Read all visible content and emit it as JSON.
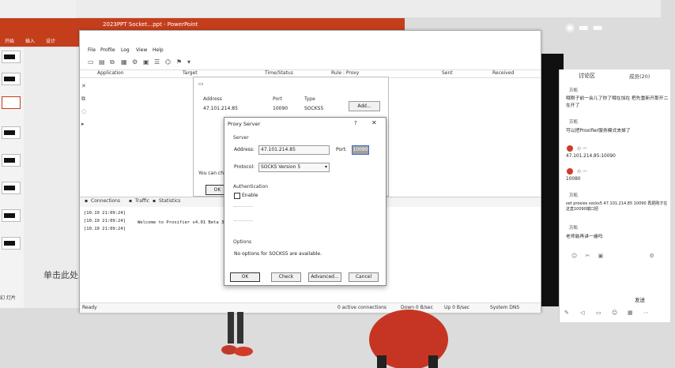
{
  "powerpoint": {
    "title": "2023PPT Socket…ppt - PowerPoint",
    "ribbon": [
      "开始",
      "插入",
      "设计"
    ],
    "slide_text": "单击此处",
    "status": "幻 灯片"
  },
  "proxifier": {
    "menu": [
      "File",
      "Profile",
      "Log",
      "View",
      "Help"
    ],
    "columns": [
      "Application",
      "Target",
      "Time/Status",
      "Rule : Proxy",
      "Sent",
      "Received"
    ],
    "servers": {
      "headers": [
        "Address",
        "Port",
        "Type"
      ],
      "row": {
        "address": "47.101.214.85",
        "port": "10090",
        "type": "SOCKS5"
      },
      "add_label": "Add...",
      "hint": "You can che",
      "ok_label": "OK"
    },
    "tabs": [
      "Connections",
      "Traffic",
      "Statistics"
    ],
    "log": [
      "[10.19 21:09:24]",
      "[10.19 21:09:24]",
      "[10.19 21:09:24]"
    ],
    "welcome": "Welcome to Proxifier v4.01 Beta 3",
    "status": {
      "ready": "Ready",
      "connections": "0 active connections",
      "down": "Down 0 B/sec",
      "up": "Up 0 B/sec",
      "dns": "System DNS"
    }
  },
  "dialog": {
    "title": "Proxy Server",
    "help": "?",
    "close": "✕",
    "server_section": "Server",
    "address_label": "Address:",
    "address_value": "47.101.214.85",
    "port_label": "Port:",
    "port_value": "10090",
    "protocol_label": "Protocol:",
    "protocol_value": "SOCKS Version 5",
    "auth_section": "Authentication",
    "enable_label": "Enable",
    "options_section": "Options",
    "options_text": "No options for SOCKS5 are available.",
    "buttons": {
      "ok": "OK",
      "check": "Check",
      "advanced": "Advanced...",
      "cancel": "Cancel"
    }
  },
  "chat": {
    "title": "讨论区",
    "members": "成员(20)",
    "messages": [
      {
        "name": "苏甄",
        "text": "哦刚子前一会儿了你了哦在加在 把先重新开那开二在开了"
      },
      {
        "name": "苏甄",
        "text": "可以把Proxifier服务模式去掉了"
      },
      {
        "name": "小 一",
        "text": "47.101.214.85:10090"
      },
      {
        "name": "小 一",
        "text": "10080"
      },
      {
        "name": "苏甄",
        "text": "set proxies socks5 47.101.214.85 10090 再把刚才在这直10090端口把"
      },
      {
        "name": "苏甄",
        "text": "老师能再讲一遍吗"
      }
    ],
    "send_label": "发送"
  },
  "colors": {
    "ppt_red": "#c43e1c",
    "avatar_red": "#d23a2a",
    "focus_blue": "#3a6fb5"
  }
}
